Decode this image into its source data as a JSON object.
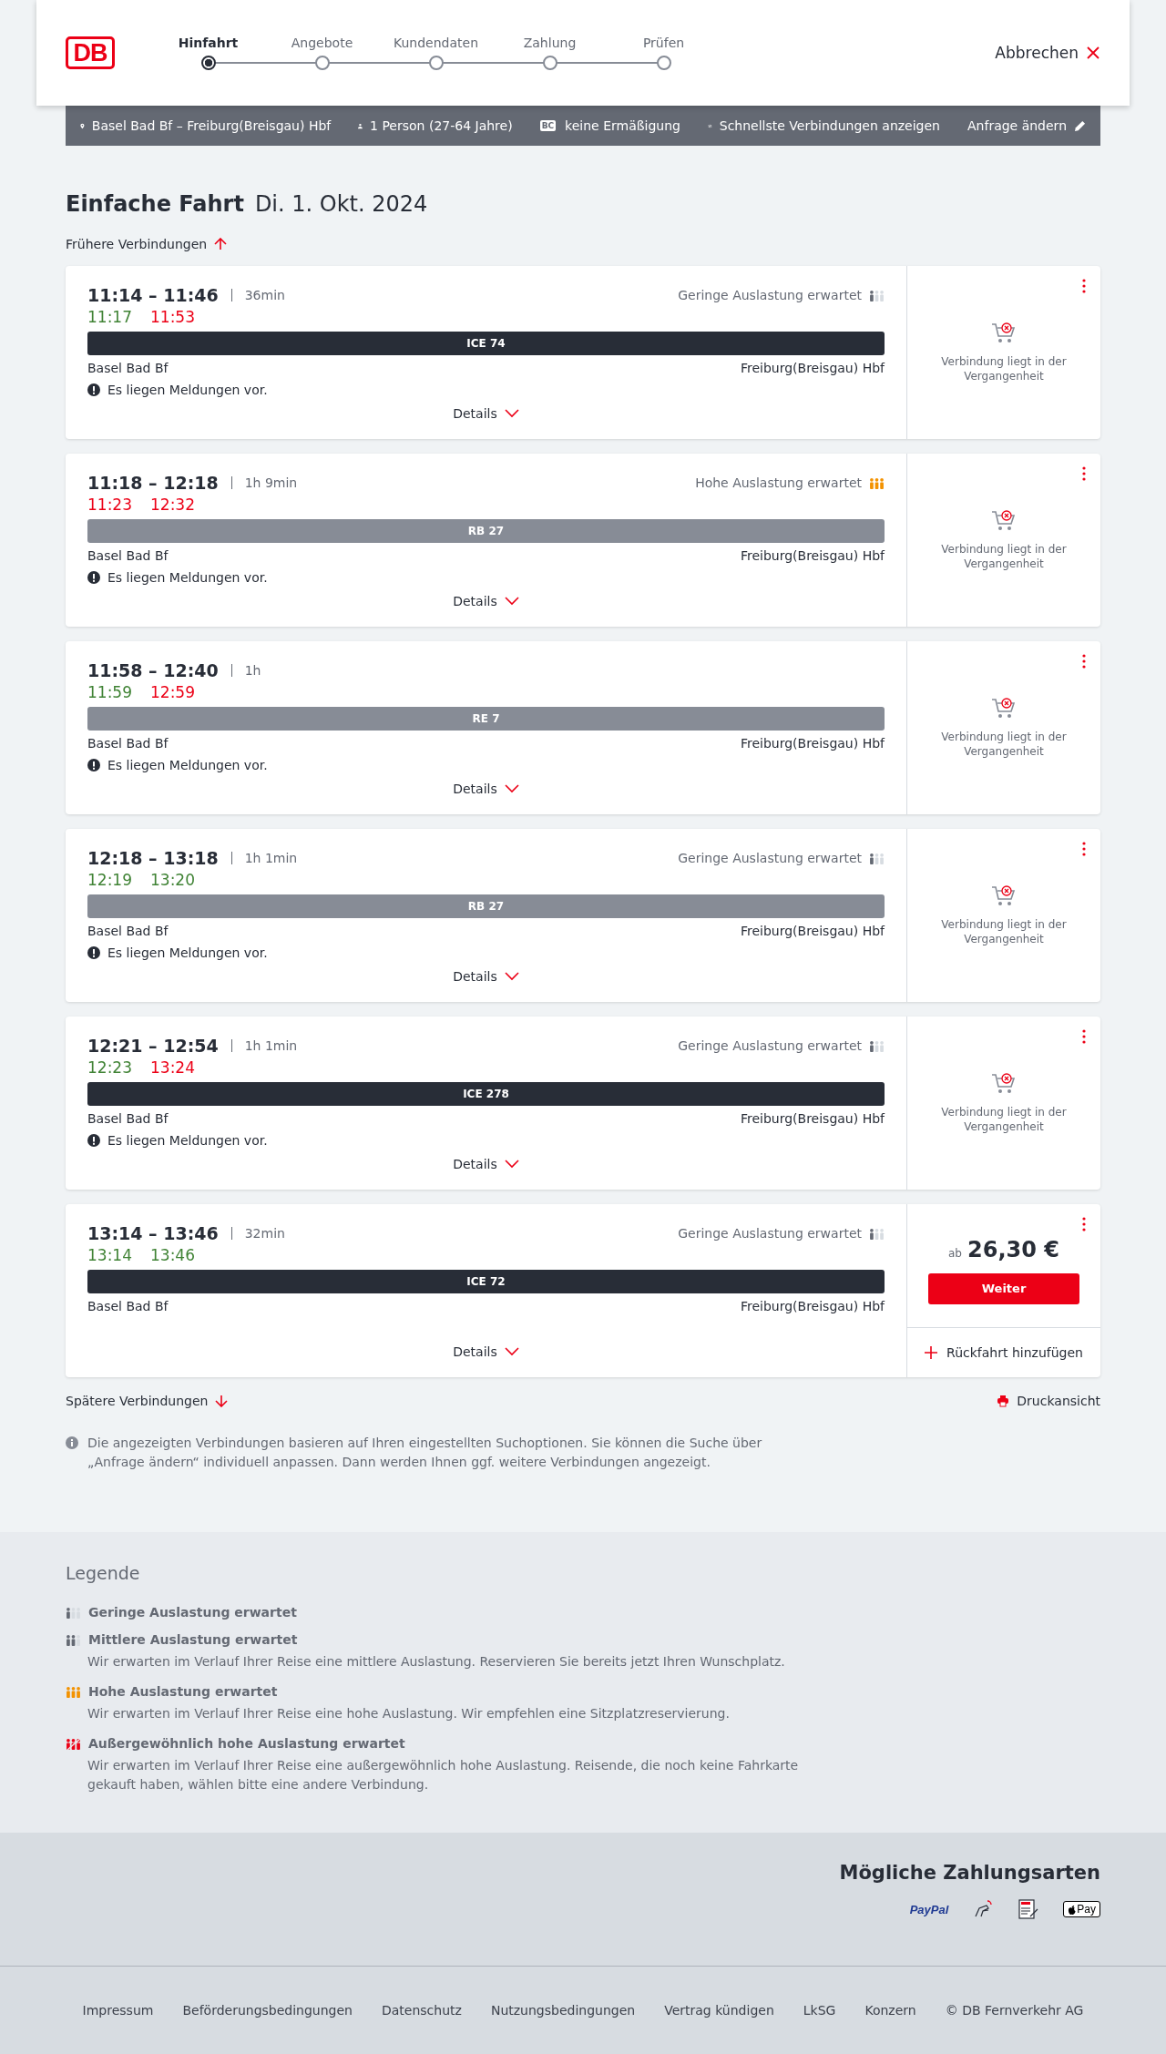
{
  "header": {
    "logo": "DB",
    "steps": [
      {
        "label": "Hinfahrt",
        "selected": true
      },
      {
        "label": "Angebote",
        "selected": false
      },
      {
        "label": "Kundendaten",
        "selected": false
      },
      {
        "label": "Zahlung",
        "selected": false
      },
      {
        "label": "Prüfen",
        "selected": false
      }
    ],
    "cancel": "Abbrechen"
  },
  "search_summary": {
    "route": "Basel Bad Bf – Freiburg(Breisgau) Hbf",
    "travellers": "1 Person (27-64 Jahre)",
    "discount_badge": "BC",
    "discount": "keine Ermäßigung",
    "option": "Schnellste Verbindungen anzeigen",
    "edit": "Anfrage ändern"
  },
  "title": "Einfache Fahrt",
  "date": "Di. 1. Okt. 2024",
  "earlier": "Frühere Verbindungen",
  "connections": [
    {
      "time": "11:14 – 11:46",
      "duration": "36min",
      "actual_departure": {
        "time": "11:17",
        "late": false
      },
      "actual_arrival": {
        "time": "11:53",
        "late": true
      },
      "occupancy": {
        "text": "Geringe Auslastung erwartet",
        "kind": "low"
      },
      "train": {
        "name": "ICE 74",
        "kind": "long_distance"
      },
      "from": "Basel Bad Bf",
      "to": "Freiburg(Breisgau) Hbf",
      "message": "Es liegen Meldungen vor.",
      "details": "Details",
      "offer": {
        "kind": "past",
        "text": "Verbindung liegt in der Vergangenheit"
      }
    },
    {
      "time": "11:18 – 12:18",
      "duration": "1h 9min",
      "actual_departure": {
        "time": "11:23",
        "late": true
      },
      "actual_arrival": {
        "time": "12:32",
        "late": true
      },
      "occupancy": {
        "text": "Hohe Auslastung erwartet",
        "kind": "high"
      },
      "train": {
        "name": "RB 27",
        "kind": "regional"
      },
      "from": "Basel Bad Bf",
      "to": "Freiburg(Breisgau) Hbf",
      "message": "Es liegen Meldungen vor.",
      "details": "Details",
      "offer": {
        "kind": "past",
        "text": "Verbindung liegt in der Vergangenheit"
      }
    },
    {
      "time": "11:58 – 12:40",
      "duration": "1h",
      "actual_departure": {
        "time": "11:59",
        "late": false
      },
      "actual_arrival": {
        "time": "12:59",
        "late": true
      },
      "train": {
        "name": "RE 7",
        "kind": "regional"
      },
      "from": "Basel Bad Bf",
      "to": "Freiburg(Breisgau) Hbf",
      "message": "Es liegen Meldungen vor.",
      "details": "Details",
      "offer": {
        "kind": "past",
        "text": "Verbindung liegt in der Vergangenheit"
      }
    },
    {
      "time": "12:18 – 13:18",
      "duration": "1h 1min",
      "actual_departure": {
        "time": "12:19",
        "late": false
      },
      "actual_arrival": {
        "time": "13:20",
        "late": false
      },
      "occupancy": {
        "text": "Geringe Auslastung erwartet",
        "kind": "low"
      },
      "train": {
        "name": "RB 27",
        "kind": "regional"
      },
      "from": "Basel Bad Bf",
      "to": "Freiburg(Breisgau) Hbf",
      "message": "Es liegen Meldungen vor.",
      "details": "Details",
      "offer": {
        "kind": "past",
        "text": "Verbindung liegt in der Vergangenheit"
      }
    },
    {
      "time": "12:21 – 12:54",
      "duration": "1h 1min",
      "actual_departure": {
        "time": "12:23",
        "late": false
      },
      "actual_arrival": {
        "time": "13:24",
        "late": true
      },
      "occupancy": {
        "text": "Geringe Auslastung erwartet",
        "kind": "low"
      },
      "train": {
        "name": "ICE 278",
        "kind": "long_distance"
      },
      "from": "Basel Bad Bf",
      "to": "Freiburg(Breisgau) Hbf",
      "message": "Es liegen Meldungen vor.",
      "details": "Details",
      "offer": {
        "kind": "past",
        "text": "Verbindung liegt in der Vergangenheit"
      }
    },
    {
      "time": "13:14 – 13:46",
      "duration": "32min",
      "actual_departure": {
        "time": "13:14",
        "late": false
      },
      "actual_arrival": {
        "time": "13:46",
        "late": false
      },
      "occupancy": {
        "text": "Geringe Auslastung erwartet",
        "kind": "low"
      },
      "train": {
        "name": "ICE 72",
        "kind": "long_distance"
      },
      "from": "Basel Bad Bf",
      "to": "Freiburg(Breisgau) Hbf",
      "details": "Details",
      "offer": {
        "kind": "price",
        "prefix": "ab",
        "price": "26,30 €",
        "button": "Weiter",
        "return": "Rückfahrt hinzufügen"
      }
    }
  ],
  "later": "Spätere Verbindungen",
  "print": "Druckansicht",
  "notice": "Die angezeigten Verbindungen basieren auf Ihren eingestellten Suchoptionen. Sie können die Suche über „Anfrage ändern“ individuell anpassen. Dann werden Ihnen ggf. weitere Verbindungen angezeigt.",
  "legend": {
    "title": "Legende",
    "items": [
      {
        "kind": "low",
        "title": "Geringe Auslastung erwartet"
      },
      {
        "kind": "medium",
        "title": "Mittlere Auslastung erwartet",
        "text": "Wir erwarten im Verlauf Ihrer Reise eine mittlere Auslastung. Reservieren Sie bereits jetzt Ihren Wunschplatz."
      },
      {
        "kind": "high",
        "title": "Hohe Auslastung erwartet",
        "text": "Wir erwarten im Verlauf Ihrer Reise eine hohe Auslastung. Wir empfehlen eine Sitzplatzreservierung."
      },
      {
        "kind": "extreme",
        "title": "Außergewöhnlich hohe Auslastung erwartet",
        "text": "Wir erwarten im Verlauf Ihrer Reise eine außergewöhnlich hohe Auslastung. Reisende, die noch keine Fahrkarte gekauft haben, wählen bitte eine andere Verbindung."
      }
    ]
  },
  "payment": {
    "title": "Mögliche Zahlungsarten",
    "methods": [
      {
        "kind": "paypal",
        "label": "PayPal"
      },
      {
        "kind": "contactless"
      },
      {
        "kind": "sepa"
      },
      {
        "kind": "applepay",
        "label": "Pay"
      }
    ]
  },
  "footer_links": [
    "Impressum",
    "Beförderungsbedingungen",
    "Datenschutz",
    "Nutzungsbedingungen",
    "Vertrag kündigen",
    "LkSG",
    "Konzern",
    "© DB Fernverkehr AG"
  ]
}
